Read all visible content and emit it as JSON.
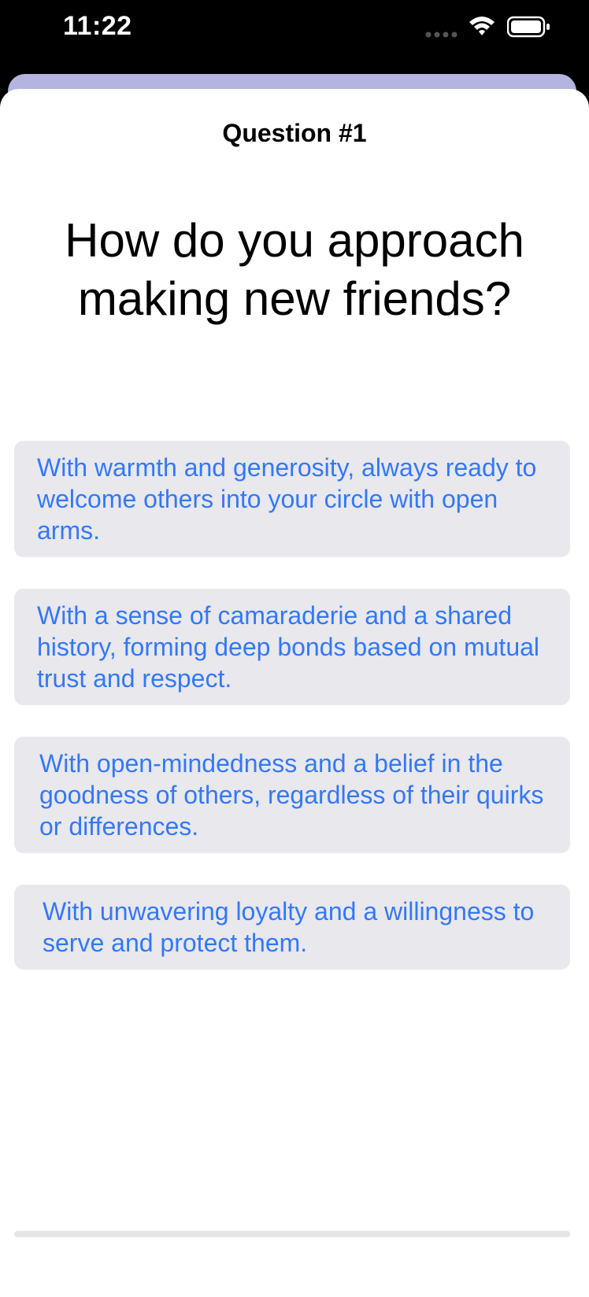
{
  "status_bar": {
    "time": "11:22",
    "icons": [
      "cellular-signal-icon",
      "wifi-icon",
      "battery-icon"
    ]
  },
  "quiz": {
    "question_number": "Question #1",
    "question": "How do you approach making new friends?",
    "answers": [
      {
        "label": "With warmth and generosity, always ready to welcome others into your circle with open arms."
      },
      {
        "label": "With a sense of camaraderie and a shared history, forming deep bonds based on mutual trust and respect."
      },
      {
        "label": "With open-mindedness and a belief in the goodness of others, regardless of their quirks or differences."
      },
      {
        "label": "With unwavering loyalty and a willingness to serve and protect them."
      }
    ],
    "progress_fraction": 0
  },
  "colors": {
    "accent": "#3478f6",
    "answer_background": "#e8e8ed",
    "sheet_header": "#b3b5e0"
  }
}
